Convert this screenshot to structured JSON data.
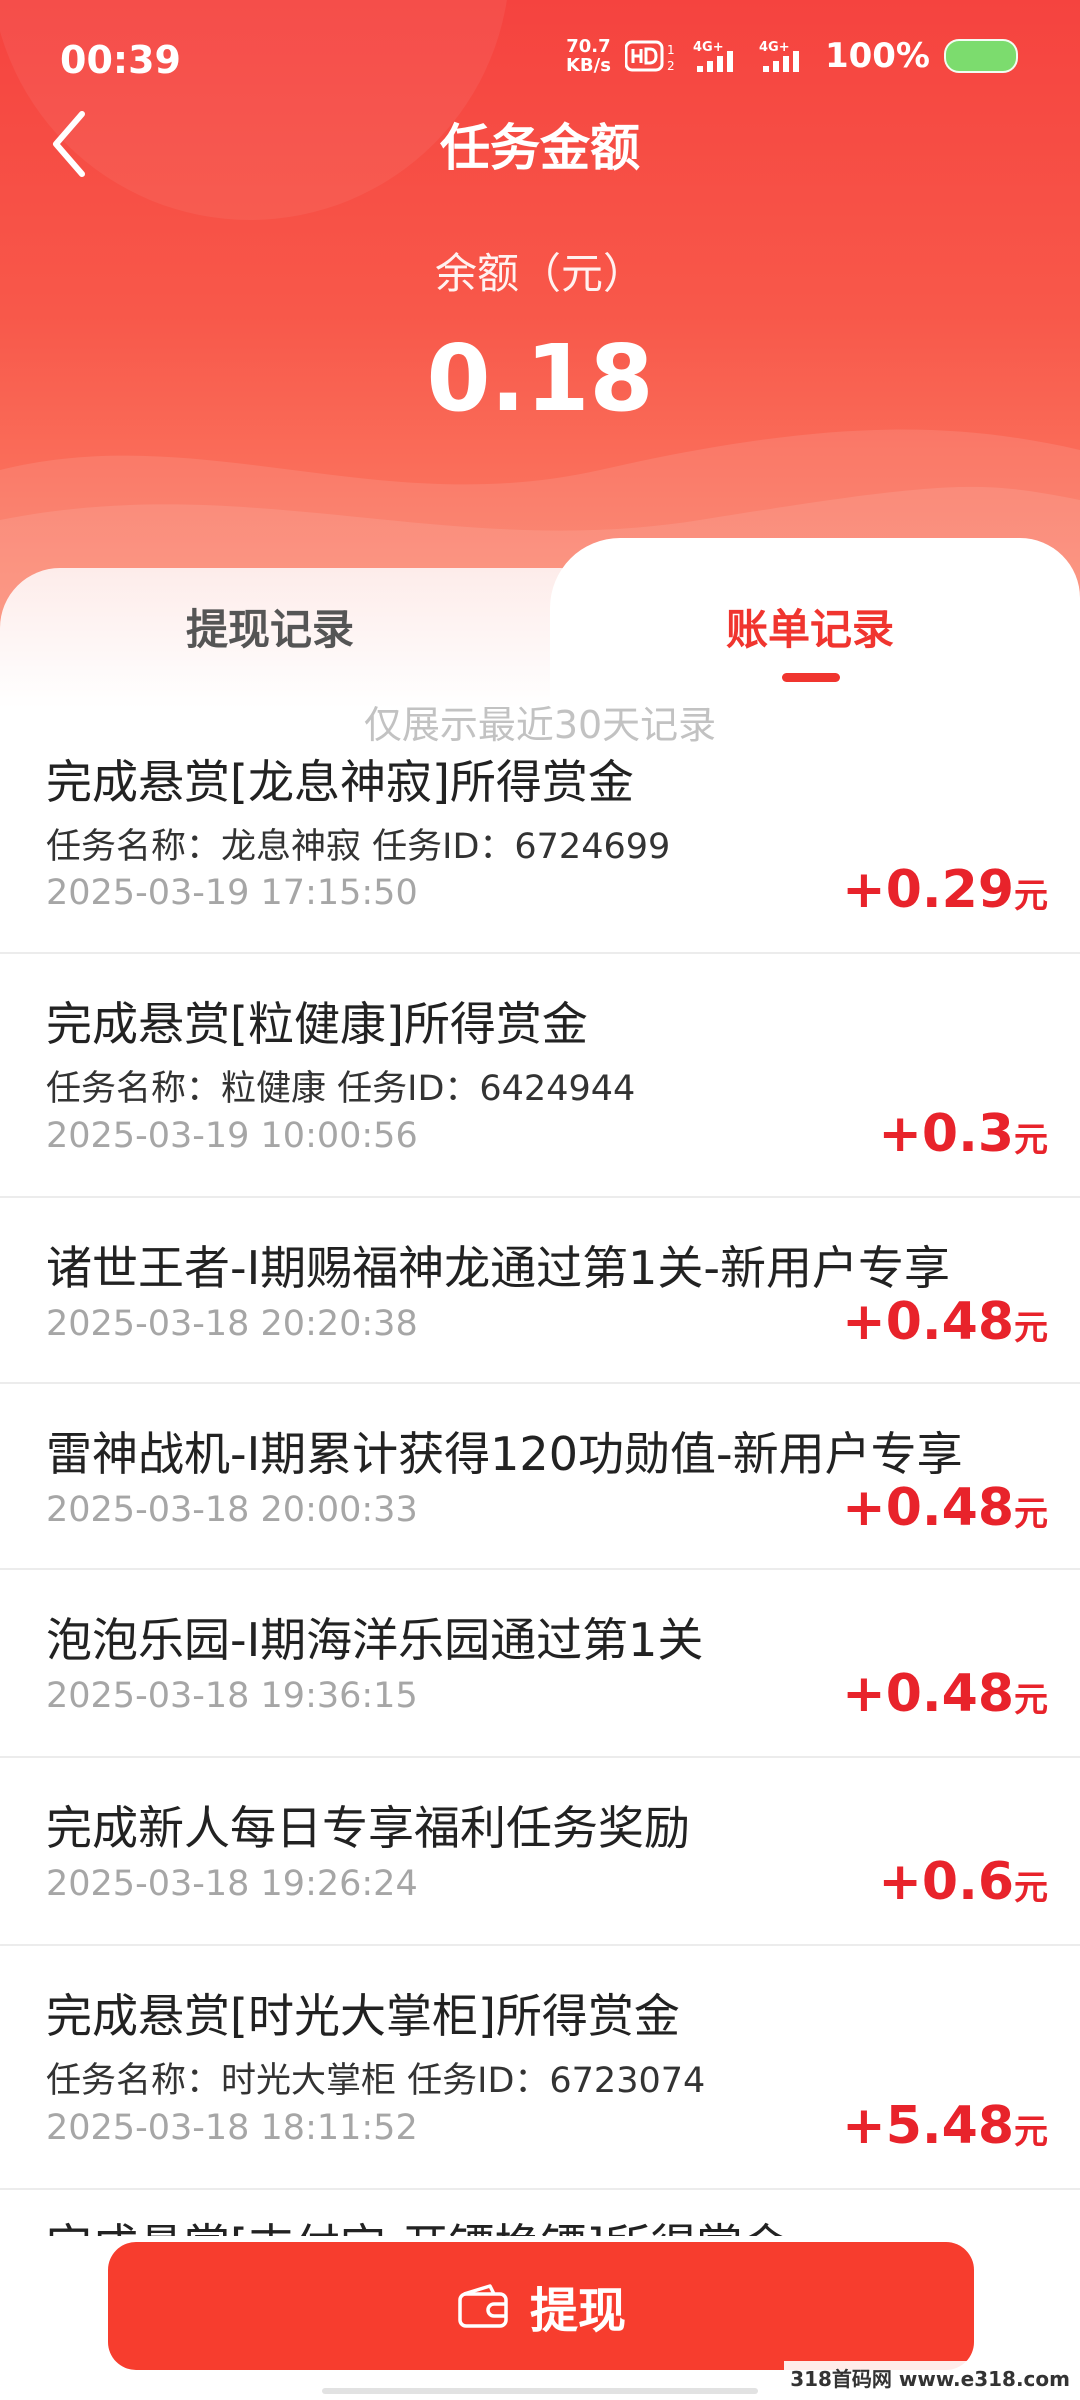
{
  "status_bar": {
    "time": "00:39",
    "net_speed_value": "70.7",
    "net_speed_unit": "KB/s",
    "battery": "100%"
  },
  "header": {
    "title": "任务金额",
    "balance_label": "余额（元）",
    "balance_value": "0.18"
  },
  "tabs": [
    {
      "label": "提现记录",
      "active": false
    },
    {
      "label": "账单记录",
      "active": true
    }
  ],
  "notice": "仅展示最近30天记录",
  "records": [
    {
      "title": "完成悬赏[龙息神寂]所得赏金",
      "sub": "任务名称：龙息神寂   任务ID：6724699",
      "time": "2025-03-19 17:15:50",
      "amount": "+0.29",
      "unit": "元"
    },
    {
      "title": "完成悬赏[粒健康]所得赏金",
      "sub": "任务名称：粒健康   任务ID：6424944",
      "time": "2025-03-19 10:00:56",
      "amount": "+0.3",
      "unit": "元"
    },
    {
      "title": "诸世王者-Ⅰ期赐福神龙通过第1关-新用户专享",
      "sub": "",
      "time": "2025-03-18 20:20:38",
      "amount": "+0.48",
      "unit": "元"
    },
    {
      "title": "雷神战机-Ⅰ期累计获得120功勋值-新用户专享",
      "sub": "",
      "time": "2025-03-18 20:00:33",
      "amount": "+0.48",
      "unit": "元"
    },
    {
      "title": "泡泡乐园-Ⅰ期海洋乐园通过第1关",
      "sub": "",
      "time": "2025-03-18 19:36:15",
      "amount": "+0.48",
      "unit": "元"
    },
    {
      "title": "完成新人每日专享福利任务奖励",
      "sub": "",
      "time": "2025-03-18 19:26:24",
      "amount": "+0.6",
      "unit": "元"
    },
    {
      "title": "完成悬赏[时光大掌柜]所得赏金",
      "sub": "任务名称：时光大掌柜   任务ID：6723074",
      "time": "2025-03-18 18:11:52",
      "amount": "+5.48",
      "unit": "元"
    }
  ],
  "partial_record_title": "完成悬赏[支付宝-开镖换镖]所得赏金",
  "withdraw_button": "提现",
  "watermark": "318首码网 www.e318.com"
}
